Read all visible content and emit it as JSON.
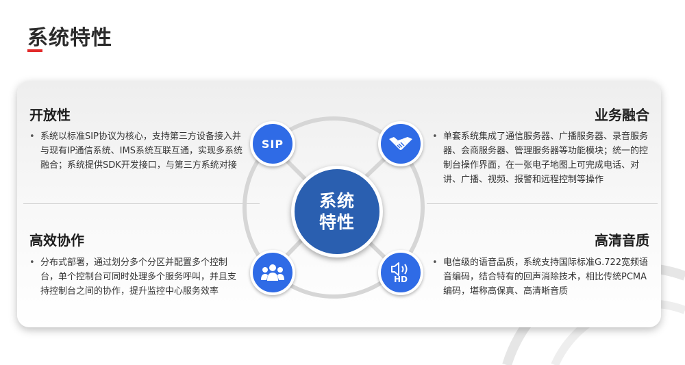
{
  "header": {
    "title": "系统特性"
  },
  "center": {
    "line1": "系统",
    "line2": "特性"
  },
  "sections": {
    "openness": {
      "title": "开放性",
      "body": "系统以标准SIP协议为核心，支持第三方设备接入并与现有IP通信系统、IMS系统互联互通，实现多系统融合；系统提供SDK开发接口，与第三方系统对接",
      "icon_text": "SIP"
    },
    "integration": {
      "title": "业务融合",
      "body": "单套系统集成了通信服务器、广播服务器、录音服务器、会商服务器、管理服务器等功能模块；统一的控制台操作界面，在一张电子地图上可完成电话、对讲、广播、视频、报警和远程控制等操作"
    },
    "collaboration": {
      "title": "高效协作",
      "body": "分布式部署，通过划分多个分区并配置多个控制台，单个控制台可同时处理多个服务呼叫，并且支持控制台之间的协作，提升监控中心服务效率"
    },
    "audio": {
      "title": "高清音质",
      "body": "电信级的语音品质，系统支持国际标准G.722宽频语音编码，结合特有的回声消除技术，相比传统PCMA编码，堪称高保真、高清晰音质",
      "icon_text": "HD"
    }
  },
  "colors": {
    "accent_red": "#e22b2b",
    "icon_blue": "#2f6be6",
    "center_blue": "#2a5fb0"
  }
}
